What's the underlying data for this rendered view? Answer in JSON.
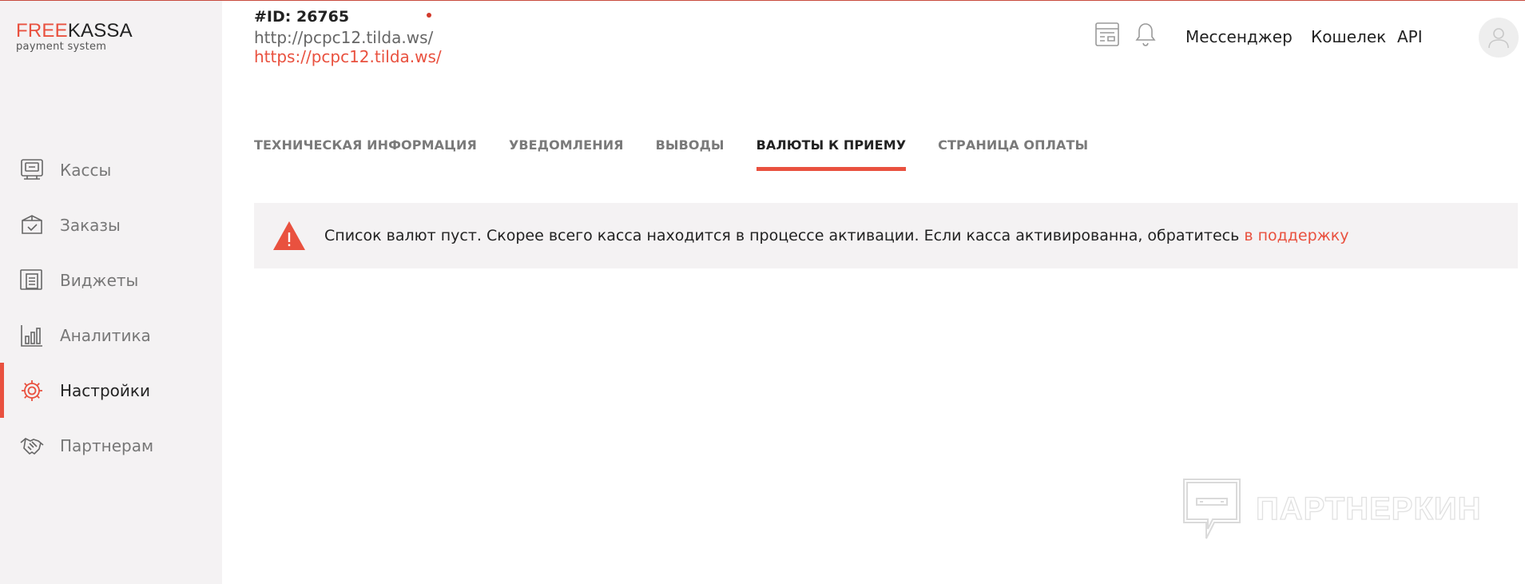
{
  "brand": {
    "logo_red": "FREE",
    "logo_dark": "KASSA",
    "tagline": "payment system",
    "accent_color": "#e9513f"
  },
  "sidebar": {
    "items": [
      {
        "label": "Кассы",
        "icon": "cash-register-icon",
        "active": false
      },
      {
        "label": "Заказы",
        "icon": "order-box-icon",
        "active": false
      },
      {
        "label": "Виджеты",
        "icon": "widgets-icon",
        "active": false
      },
      {
        "label": "Аналитика",
        "icon": "analytics-chart-icon",
        "active": false
      },
      {
        "label": "Настройки",
        "icon": "gear-icon",
        "active": true
      },
      {
        "label": "Партнерам",
        "icon": "handshake-icon",
        "active": false
      }
    ]
  },
  "header": {
    "cash_id": "#ID: 26765",
    "url_http": "http://pcpc12.tilda.ws/",
    "url_https": "https://pcpc12.tilda.ws/",
    "links": {
      "messenger": "Мессенджер",
      "wallet": "Кошелек",
      "api": "API"
    }
  },
  "tabs": [
    {
      "label": "ТЕХНИЧЕСКАЯ ИНФОРМАЦИЯ",
      "active": false
    },
    {
      "label": "УВЕДОМЛЕНИЯ",
      "active": false
    },
    {
      "label": "ВЫВОДЫ",
      "active": false
    },
    {
      "label": "ВАЛЮТЫ К ПРИЕМУ",
      "active": true
    },
    {
      "label": "СТРАНИЦА ОПЛАТЫ",
      "active": false
    }
  ],
  "alert": {
    "text": "Список валют пуст. Скорее всего касса находится в процессе активации. Если касса активированна, обратитесь ",
    "link": "в поддержку"
  },
  "watermark": {
    "text": "ПАРТНЕРКИН"
  }
}
